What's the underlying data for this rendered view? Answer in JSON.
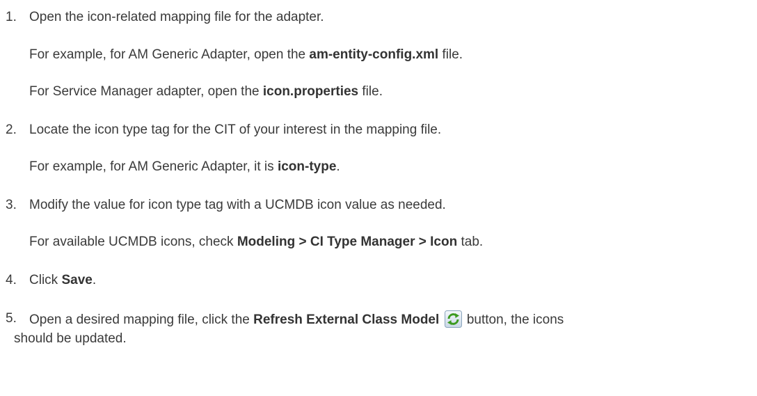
{
  "steps": [
    {
      "number": "1.",
      "text": "Open the icon-related mapping file for the adapter.",
      "subs": [
        {
          "pre": "For example, for AM Generic Adapter, open the ",
          "bold": "am-entity-config.xml",
          "post": " file."
        },
        {
          "pre": "For Service Manager adapter, open the ",
          "bold": "icon.properties",
          "post": " file."
        }
      ]
    },
    {
      "number": "2.",
      "text": "Locate the icon type tag for the CIT of your interest in the mapping file.",
      "subs": [
        {
          "pre": "For example, for AM Generic Adapter, it is ",
          "bold": "icon-type",
          "post": "."
        }
      ]
    },
    {
      "number": "3.",
      "text": "Modify the value for icon type tag with a UCMDB icon value as needed.",
      "subs": [
        {
          "pre": "For available UCMDB icons, check ",
          "bold": "Modeling > CI Type Manager > Icon",
          "post": " tab."
        }
      ]
    },
    {
      "number": "4.",
      "pre": "Click ",
      "bold": "Save",
      "post": "."
    },
    {
      "number": "5.",
      "pre": "Open a desired mapping file, click the ",
      "bold": "Refresh External Class Model",
      "icon": "refresh-icon",
      "post": " button, the icons",
      "continuation": "should be updated."
    }
  ],
  "colors": {
    "text": "#3a3a3a",
    "icon_green": "#4caf2a"
  }
}
